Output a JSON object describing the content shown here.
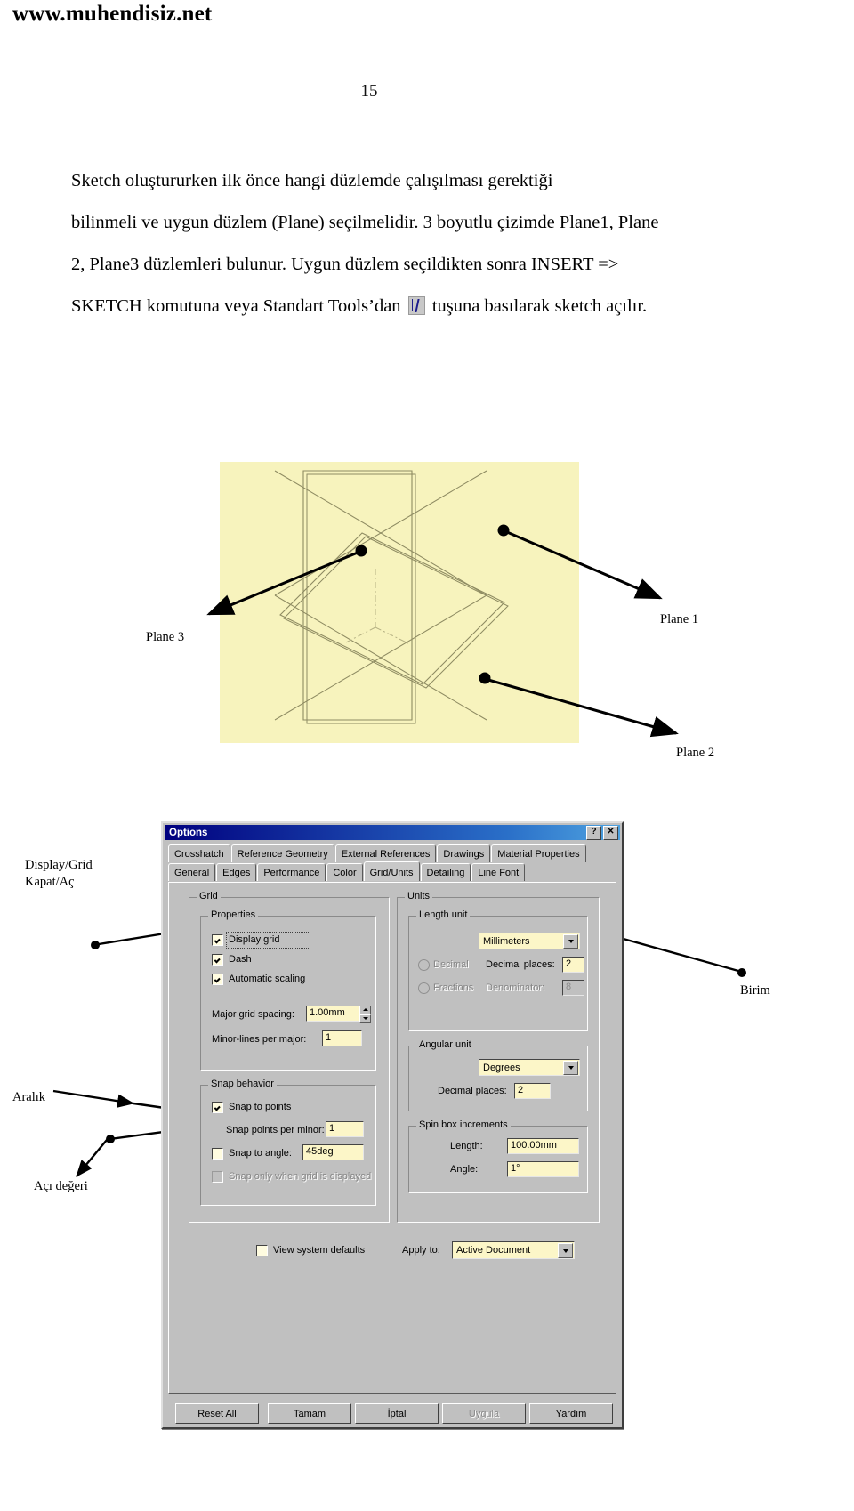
{
  "header": {
    "site_url": "www.muhendisiz.net"
  },
  "page_number": "15",
  "body": {
    "line1": "Sketch  oluştururken   ilk   önce   hangi   düzlemde   çalışılması   gerektiği",
    "line2": "bilinmeli ve uygun düzlem (Plane) seçilmelidir. 3 boyutlu çizimde Plane1, Plane",
    "line3": "2,  Plane3  düzlemleri  bulunur.  Uygun  düzlem  seçildikten  sonra  INSERT  =>",
    "line4_a": "SKETCH komutuna veya Standart Tools’dan",
    "line4_b": "tuşuna basılarak sketch açılır.",
    "sketch_icon_name": "sketch-tool-icon"
  },
  "figure": {
    "plane1": "Plane 1",
    "plane2": "Plane 2",
    "plane3": "Plane 3",
    "background_color": "#f7f3bd"
  },
  "annotations": {
    "display_grid_line1": "Display/Grid",
    "display_grid_line2": "Kapat/Aç",
    "birim": "Birim",
    "aralik": "Aralık",
    "aci_degeri": "Açı değeri"
  },
  "dialog": {
    "title": "Options",
    "help_button": "?",
    "close_button": "✕",
    "tabs_row1": [
      {
        "label": "Crosshatch",
        "active": false
      },
      {
        "label": "Reference Geometry",
        "active": false
      },
      {
        "label": "External References",
        "active": false
      },
      {
        "label": "Drawings",
        "active": false
      },
      {
        "label": "Material Properties",
        "active": false
      }
    ],
    "tabs_row2": [
      {
        "label": "General",
        "active": false
      },
      {
        "label": "Edges",
        "active": false
      },
      {
        "label": "Performance",
        "active": false
      },
      {
        "label": "Color",
        "active": false
      },
      {
        "label": "Grid/Units",
        "active": true
      },
      {
        "label": "Detailing",
        "active": false
      },
      {
        "label": "Line Font",
        "active": false
      }
    ],
    "grid_group": {
      "title": "Grid",
      "properties_title": "Properties",
      "display_grid": {
        "label": "Display grid",
        "checked": true
      },
      "dash": {
        "label": "Dash",
        "checked": true
      },
      "automatic_scaling": {
        "label": "Automatic scaling",
        "checked": true
      },
      "major_grid_spacing": {
        "label": "Major grid spacing:",
        "value": "1.00mm"
      },
      "minor_lines_per_major": {
        "label": "Minor-lines per major:",
        "value": "1"
      },
      "snap_behavior_title": "Snap behavior",
      "snap_to_points": {
        "label": "Snap to points",
        "checked": true
      },
      "snap_points_per_minor": {
        "label": "Snap points per minor:",
        "value": "1"
      },
      "snap_to_angle": {
        "label": "Snap to angle:",
        "checked": false,
        "value": "45deg"
      },
      "snap_only_when_grid": {
        "label": "Snap only when grid is displayed",
        "checked": false,
        "disabled": true
      }
    },
    "units_group": {
      "title": "Units",
      "length_unit_title": "Length unit",
      "length_unit_value": "Millimeters",
      "decimal_radio": "Decimal",
      "fractions_radio": "Fractions",
      "decimal_places_label": "Decimal places:",
      "decimal_places_value": "2",
      "denominator_label": "Denominator:",
      "denominator_value": "8",
      "angular_unit_title": "Angular unit",
      "angular_unit_value": "Degrees",
      "angular_decimal_places_label": "Decimal places:",
      "angular_decimal_places_value": "2",
      "spin_box_title": "Spin box increments",
      "spin_length_label": "Length:",
      "spin_length_value": "100.00mm",
      "spin_angle_label": "Angle:",
      "spin_angle_value": "1°"
    },
    "footer": {
      "view_system_defaults": {
        "label": "View system defaults",
        "checked": false
      },
      "apply_to_label": "Apply to:",
      "apply_to_value": "Active Document"
    },
    "buttons": [
      {
        "label": "Reset All",
        "disabled": false
      },
      {
        "label": "Tamam",
        "disabled": false
      },
      {
        "label": "İptal",
        "disabled": false
      },
      {
        "label": "Uygula",
        "disabled": true
      },
      {
        "label": "Yardım",
        "disabled": false
      }
    ]
  }
}
